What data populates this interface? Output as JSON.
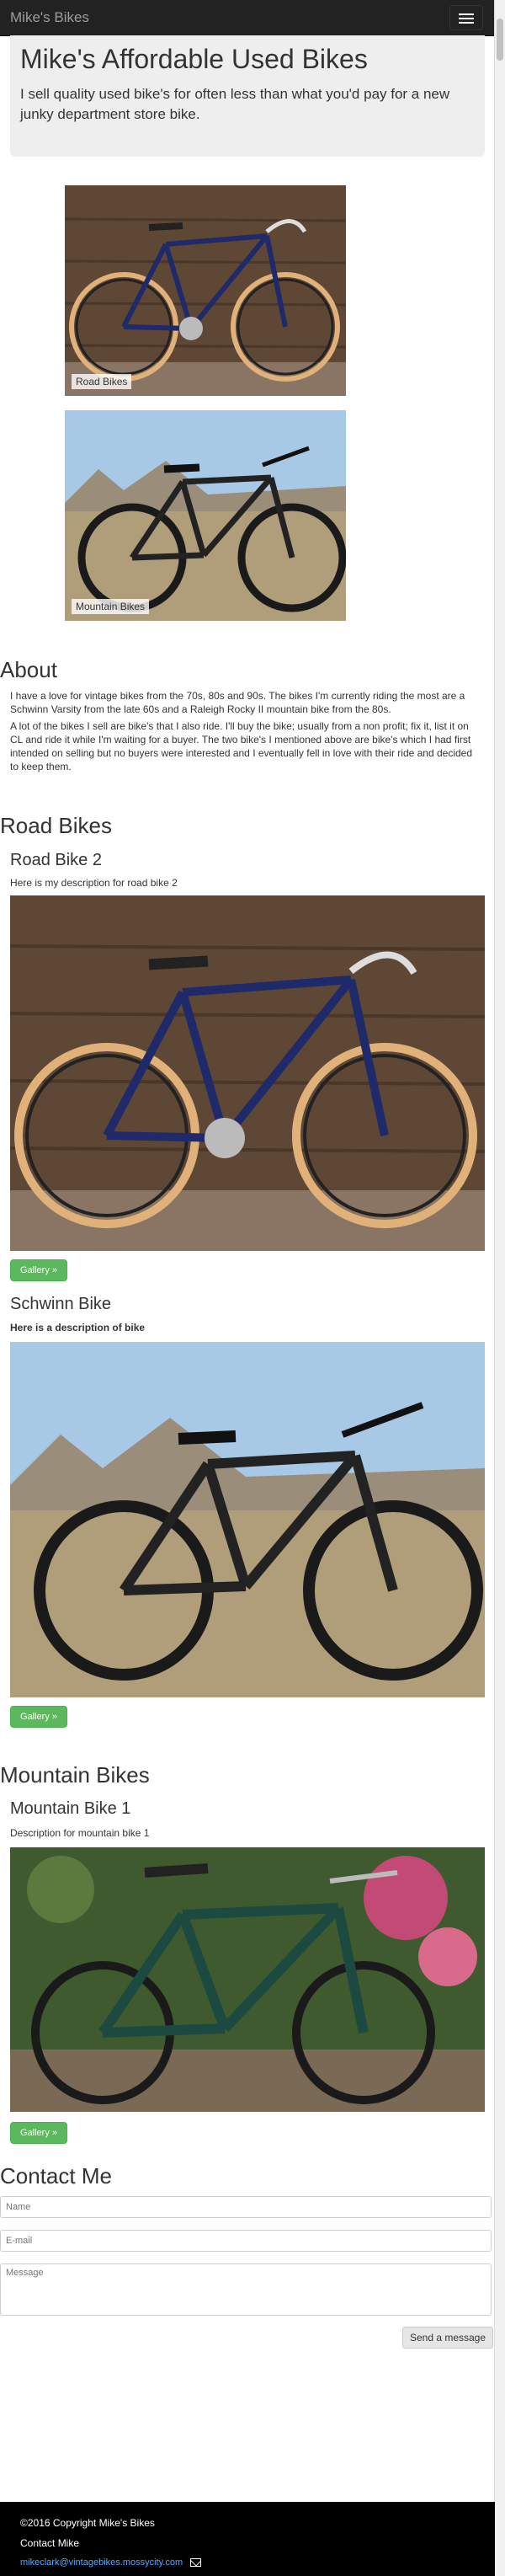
{
  "navbar": {
    "brand": "Mike's Bikes"
  },
  "hero": {
    "title": "Mike's Affordable Used Bikes",
    "subtitle": "I sell quality used bike's for often less than what you'd pay for a new junky department store bike."
  },
  "carousel": [
    {
      "caption": "Road Bikes"
    },
    {
      "caption": "Mountain Bikes"
    }
  ],
  "about": {
    "heading": "About",
    "p1": "I have a love for vintage bikes from the 70s, 80s and 90s. The bikes I'm currently riding the most are a Schwinn Varsity from the late 60s and a Raleigh Rocky II mountain bike from the 80s.",
    "p2": "A lot of the bikes I sell are bike's that I also ride. I'll buy the bike; usually from a non profit; fix it, list it on CL and ride it while I'm waiting for a buyer. The two bike's I mentioned above are bike's which I had first intended on selling but no buyers were interested and I eventually fell in love with their ride and decided to keep them."
  },
  "road": {
    "heading": "Road Bikes",
    "items": [
      {
        "title": "Road Bike 2",
        "desc": "Here is my description for road bike 2",
        "button": "Gallery »"
      },
      {
        "title": "Schwinn Bike",
        "desc": "Here is a description of bike",
        "button": "Gallery »"
      }
    ]
  },
  "mountain": {
    "heading": "Mountain Bikes",
    "items": [
      {
        "title": "Mountain Bike 1",
        "desc": "Description for mountain bike  1",
        "button": "Gallery »"
      }
    ]
  },
  "contact": {
    "heading": "Contact Me",
    "name_placeholder": "Name",
    "email_placeholder": "E-mail",
    "message_placeholder": "Message",
    "send": "Send a message"
  },
  "footer": {
    "copyright": "©2016 Copyright Mike's Bikes",
    "contact_label": "Contact Mike",
    "email": "mikeclark@vintagebikes.mossycity.com"
  }
}
